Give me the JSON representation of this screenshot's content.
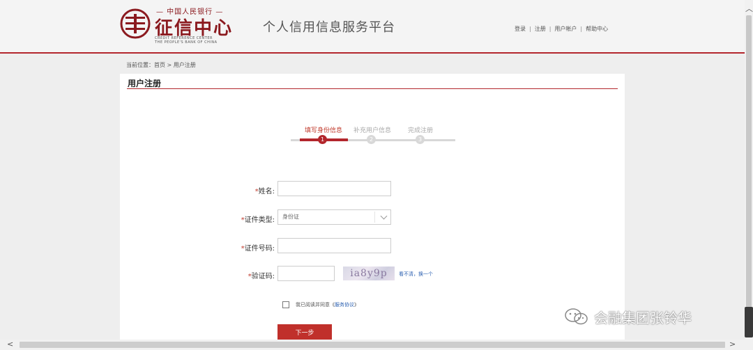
{
  "header": {
    "logo_top": "— 中国人民银行 —",
    "logo_main": "征信中心",
    "logo_en_line1": "CREDIT REFERENCE CENTER",
    "logo_en_line2": "THE PEOPLE'S BANK OF CHINA",
    "platform_title": "个人信用信息服务平台",
    "links": [
      "登录",
      "注册",
      "用户帐户",
      "帮助中心"
    ]
  },
  "breadcrumb": "当前位置：首页 > 用户注册",
  "panel": {
    "title": "用户注册",
    "steps": [
      {
        "label": "填写身份信息",
        "number": "1",
        "active": true
      },
      {
        "label": "补充用户信息",
        "number": "2",
        "active": false
      },
      {
        "label": "完成注册",
        "number": "3",
        "active": false
      }
    ],
    "form": {
      "name_label": "姓名:",
      "name_value": "",
      "id_type_label": "证件类型:",
      "id_type_value": "身份证",
      "id_number_label": "证件号码:",
      "id_number_value": "",
      "captcha_label": "验证码:",
      "captcha_value": "",
      "captcha_image_text": "ia8y9p",
      "captcha_refresh": "看不清，换一个",
      "required_mark": "*"
    },
    "agree_text": "我已阅读并同意《",
    "agree_link": "服务协议",
    "agree_end": "》",
    "next_button": "下一步"
  },
  "watermark": "会融集团张铃华",
  "colors": {
    "accent": "#b3262c",
    "link": "#2a5fb0"
  }
}
